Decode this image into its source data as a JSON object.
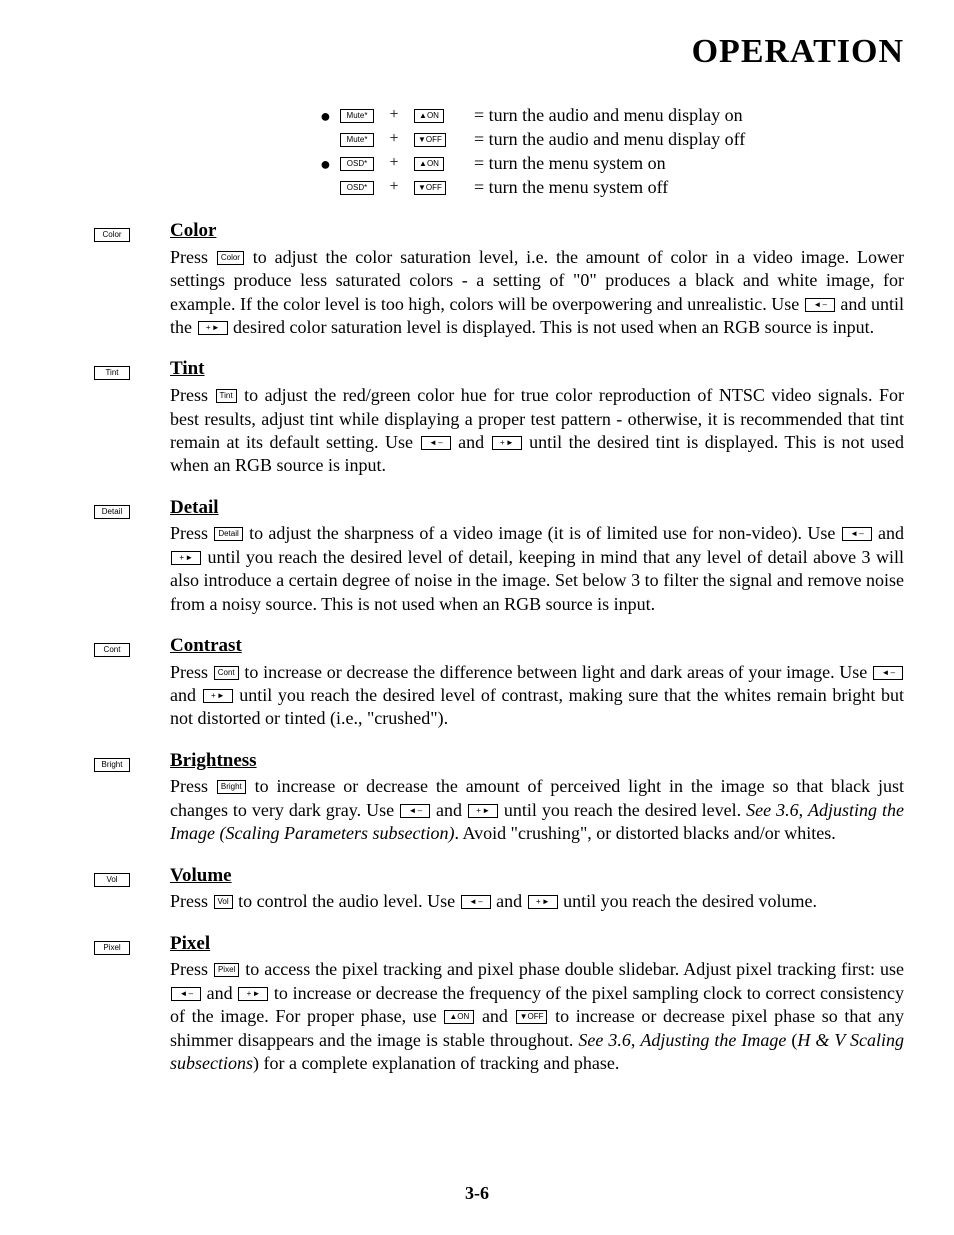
{
  "header": "OPERATION",
  "pageNumber": "3-6",
  "keys": {
    "mute": "Mute*",
    "osd": "OSD*",
    "on": "▲ON",
    "off": "▼OFF",
    "leftMinus": "◄ –",
    "plusRight": "+ ►",
    "color": "Color",
    "tint": "Tint",
    "detail": "Detail",
    "cont": "Cont",
    "bright": "Bright",
    "vol": "Vol",
    "pixel": "Pixel"
  },
  "toggles": [
    {
      "bullet": true,
      "left": "mute",
      "right": "on",
      "desc": "= turn the audio and menu display on"
    },
    {
      "bullet": false,
      "left": "mute",
      "right": "off",
      "desc": "= turn the audio and menu display off"
    },
    {
      "bullet": true,
      "left": "osd",
      "right": "on",
      "desc": "= turn the menu system on"
    },
    {
      "bullet": false,
      "left": "osd",
      "right": "off",
      "desc": "= turn the menu system off"
    }
  ],
  "sections": {
    "color": {
      "title": "Color",
      "t1": "Press ",
      "t2": " to adjust the color saturation level, i.e. the amount of color in a video image. Lower settings produce less saturated colors - a setting of \"0\" produces a black and white image, for example. If the color level is too high, colors will be overpowering and unrealistic. Use ",
      "t3": " and until the ",
      "t4": " desired color saturation level is displayed. This is not used when an RGB source is input."
    },
    "tint": {
      "title": "Tint",
      "t1": "Press ",
      "t2": " to adjust the red/green color hue for true color reproduction of NTSC video signals. For best results, adjust tint while displaying a proper test pattern - otherwise, it is recommended that tint remain at its default setting. Use ",
      "t3": " and ",
      "t4": " until the desired tint is displayed. This is not used when an RGB source is input."
    },
    "detail": {
      "title": "Detail",
      "t1": "Press ",
      "t2": " to adjust the sharpness of a video image (it is of limited use for non-video). Use ",
      "t3": " and ",
      "t4": " until you reach the desired level of detail, keeping in mind that any level of detail above 3 will also introduce a certain degree of noise in the image. Set below 3 to filter the signal and remove noise from a noisy source. This is not used when an RGB source is input."
    },
    "contrast": {
      "title": "Contrast",
      "t1": "Press ",
      "t2": " to increase or decrease the difference between light and dark areas of your image. Use ",
      "t3": " and ",
      "t4": " until you reach the desired level of contrast, making sure that the whites remain bright but not distorted or tinted (i.e., \"crushed\")."
    },
    "brightness": {
      "title": "Brightness",
      "t1": "Press ",
      "t2": " to increase or decrease the amount of perceived light in the image so that black just changes to very dark gray. Use ",
      "t3": " and ",
      "t4": " until you reach the desired level. ",
      "t5": "See 3.6",
      "t6": ", ",
      "t7": "Adjusting the Image (Scaling Parameters subsection)",
      "t8": ". Avoid \"crushing\", or distorted blacks and/or whites."
    },
    "volume": {
      "title": "Volume",
      "t1": "Press ",
      "t2": " to control the audio level. Use ",
      "t3": " and ",
      "t4": " until you reach the desired volume."
    },
    "pixel": {
      "title": "Pixel",
      "t1": "Press ",
      "t2": " to access the pixel tracking and pixel phase double slidebar. Adjust pixel tracking first: use ",
      "t3": " and ",
      "t4": " to increase or decrease the frequency of the pixel sampling clock to correct consistency of the image. For proper phase, use ",
      "t5": " and ",
      "t6": " to increase or decrease pixel phase so that any shimmer disappears and the image is stable throughout. ",
      "t7": "See 3.6",
      "t8": ", ",
      "t9": "Adjusting the Image",
      "t10": " (",
      "t11": "H & V Scaling subsections",
      "t12": ") for a complete explanation of tracking and phase."
    }
  }
}
